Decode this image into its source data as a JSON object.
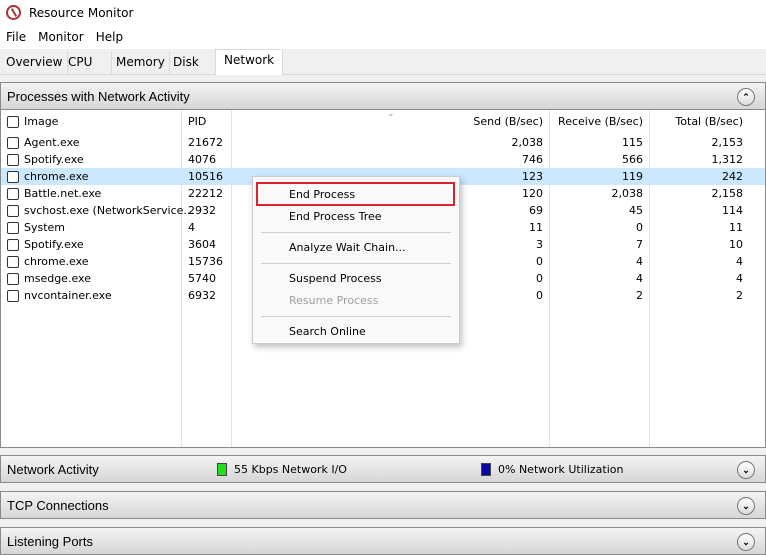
{
  "window": {
    "title": "Resource Monitor"
  },
  "menu": [
    "File",
    "Monitor",
    "Help"
  ],
  "tabs": [
    "Overview",
    "CPU",
    "Memory",
    "Disk",
    "Network"
  ],
  "processes": {
    "title": "Processes with Network Activity",
    "columns": [
      "Image",
      "PID",
      "Send (B/sec)",
      "Receive (B/sec)",
      "Total (B/sec)"
    ],
    "rows": [
      {
        "image": "Agent.exe",
        "pid": "21672",
        "send": "2,038",
        "recv": "115",
        "total": "2,153"
      },
      {
        "image": "Spotify.exe",
        "pid": "4076",
        "send": "746",
        "recv": "566",
        "total": "1,312"
      },
      {
        "image": "chrome.exe",
        "pid": "10516",
        "send": "123",
        "recv": "119",
        "total": "242"
      },
      {
        "image": "Battle.net.exe",
        "pid": "22212",
        "send": "120",
        "recv": "2,038",
        "total": "2,158"
      },
      {
        "image": "svchost.exe (NetworkService...",
        "pid": "2932",
        "send": "69",
        "recv": "45",
        "total": "114"
      },
      {
        "image": "System",
        "pid": "4",
        "send": "11",
        "recv": "0",
        "total": "11"
      },
      {
        "image": "Spotify.exe",
        "pid": "3604",
        "send": "3",
        "recv": "7",
        "total": "10"
      },
      {
        "image": "chrome.exe",
        "pid": "15736",
        "send": "0",
        "recv": "4",
        "total": "4"
      },
      {
        "image": "msedge.exe",
        "pid": "5740",
        "send": "0",
        "recv": "4",
        "total": "4"
      },
      {
        "image": "nvcontainer.exe",
        "pid": "6932",
        "send": "0",
        "recv": "2",
        "total": "2"
      }
    ]
  },
  "context_menu": {
    "items": [
      "End Process",
      "End Process Tree",
      "Analyze Wait Chain...",
      "Suspend Process",
      "Resume Process",
      "Search Online"
    ]
  },
  "network_activity": {
    "title": "Network Activity",
    "io": "55 Kbps Network I/O",
    "util": "0% Network Utilization",
    "io_color": "#22dd22",
    "util_color": "#0a0aa0"
  },
  "tcp": {
    "title": "TCP Connections"
  },
  "listening": {
    "title": "Listening Ports"
  }
}
